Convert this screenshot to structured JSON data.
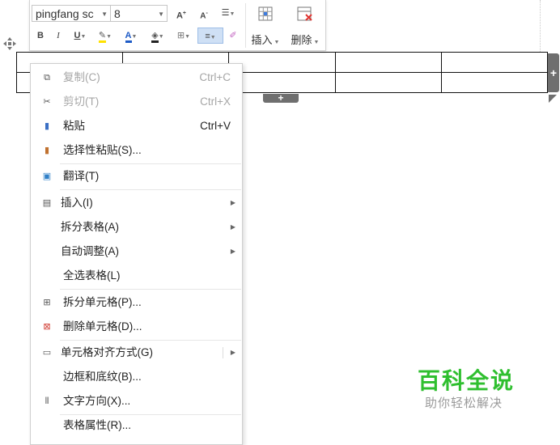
{
  "toolbar": {
    "font_name": "pingfang sc",
    "font_size": "8",
    "grow_font": "A",
    "shrink_font": "A",
    "bold": "B",
    "italic": "I",
    "underline": "U",
    "font_color": "A",
    "insert_label": "插入",
    "delete_label": "删除"
  },
  "menu": {
    "items": [
      {
        "label": "复制(C)",
        "shortcut": "Ctrl+C",
        "icon": "copy-icon"
      },
      {
        "label": "剪切(T)",
        "shortcut": "Ctrl+X",
        "icon": "cut-icon"
      },
      {
        "label": "粘贴",
        "shortcut": "Ctrl+V",
        "icon": "paste-icon"
      },
      {
        "label": "选择性粘贴(S)...",
        "icon": "paste-special-icon"
      },
      {
        "label": "翻译(T)",
        "icon": "translate-icon"
      },
      {
        "label": "插入(I)",
        "icon": "insert-table-icon"
      },
      {
        "label": "拆分表格(A)"
      },
      {
        "label": "自动调整(A)"
      },
      {
        "label": "全选表格(L)"
      },
      {
        "label": "拆分单元格(P)...",
        "icon": "split-cells-icon"
      },
      {
        "label": "删除单元格(D)...",
        "icon": "delete-cells-icon"
      },
      {
        "label": "单元格对齐方式(G)",
        "icon": "cell-align-icon"
      },
      {
        "label": "边框和底纹(B)..."
      },
      {
        "label": "文字方向(X)...",
        "icon": "text-direction-icon"
      },
      {
        "label": "表格属性(R)..."
      }
    ]
  },
  "watermark": {
    "title": "百科全说",
    "subtitle": "助你轻松解决"
  },
  "colors": {
    "watermark_green": "#2fbf2f",
    "handle_gray": "#6f6f6f",
    "selected_button": "#cfe0f5"
  }
}
